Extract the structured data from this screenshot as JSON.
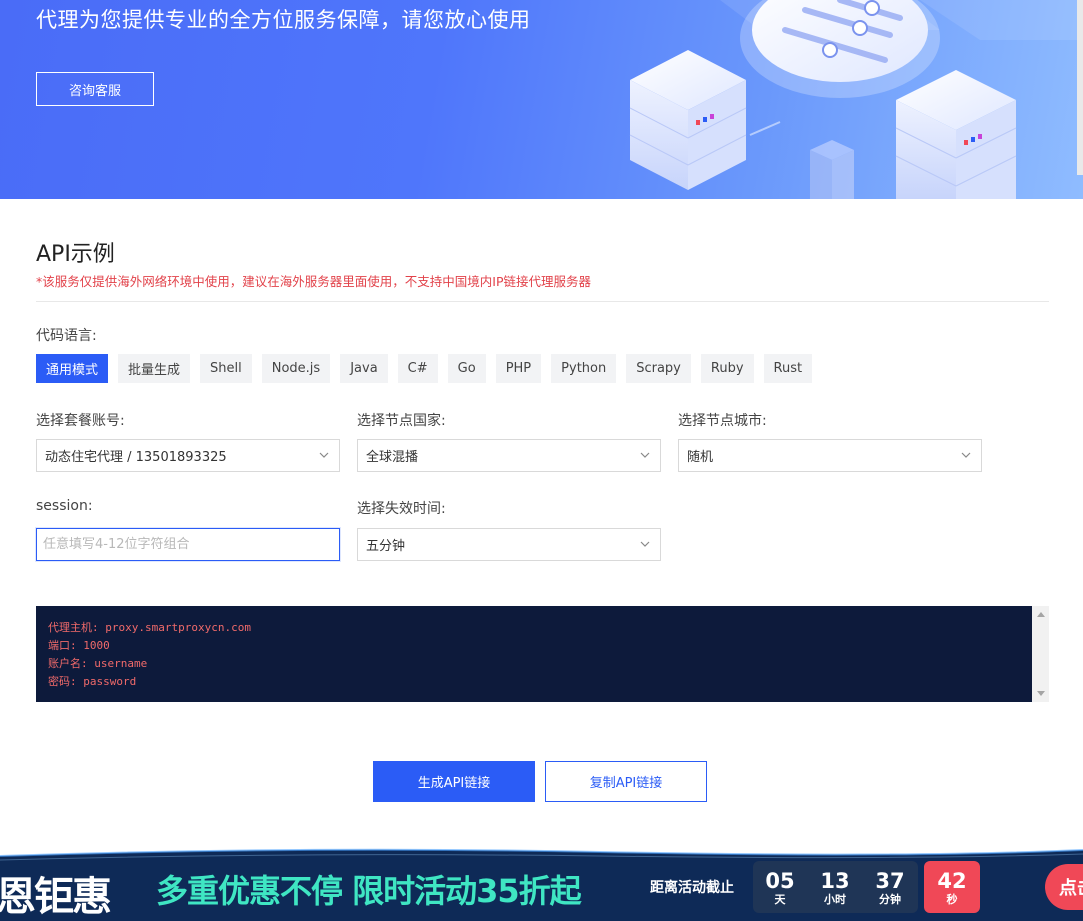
{
  "hero": {
    "subtitle": "代理为您提供专业的全方位服务保障，请您放心使用",
    "contact_button": "咨询客服"
  },
  "api_section": {
    "title": "API示例",
    "warning": "*该服务仅提供海外网络环境中使用，建议在海外服务器里面使用，不支持中国境内IP链接代理服务器",
    "code_language_label": "代码语言:",
    "languages": [
      "通用模式",
      "批量生成",
      "Shell",
      "Node.js",
      "Java",
      "C#",
      "Go",
      "PHP",
      "Python",
      "Scrapy",
      "Ruby",
      "Rust"
    ],
    "active_language": "通用模式"
  },
  "form": {
    "package_label": "选择套餐账号:",
    "package_value": "动态住宅代理 / 13501893325",
    "country_label": "选择节点国家:",
    "country_value": "全球混播",
    "city_label": "选择节点城市:",
    "city_value": "随机",
    "session_label": "session:",
    "session_value": "",
    "session_placeholder": "任意填写4-12位字符组合",
    "expire_label": "选择失效时间:",
    "expire_value": "五分钟"
  },
  "code_output": {
    "lines": [
      "代理主机: proxy.smartproxycn.com",
      "端口: 1000",
      "账户名: username",
      "密码: password"
    ]
  },
  "actions": {
    "generate": "生成API链接",
    "copy": "复制API链接"
  },
  "promo": {
    "brand": "恩钜惠",
    "headline": "多重优惠不停 限时活动35折起",
    "until_label": "距离活动截止",
    "countdown": {
      "days": "05",
      "days_unit": "天",
      "hours": "13",
      "hours_unit": "小时",
      "minutes": "37",
      "minutes_unit": "分钟",
      "seconds": "42",
      "seconds_unit": "秒"
    },
    "cta": "点击"
  },
  "colors": {
    "primary": "#2b5cf6",
    "warning": "#e2424a",
    "code_bg": "#0d1a3b",
    "code_text": "#f06a6a",
    "promo_accent": "#3fe6c3",
    "promo_red": "#f04857"
  },
  "icons": {
    "select_chevron": "chevron-down-icon",
    "scroll_up": "scroll-up-icon",
    "scroll_down": "scroll-down-icon"
  }
}
